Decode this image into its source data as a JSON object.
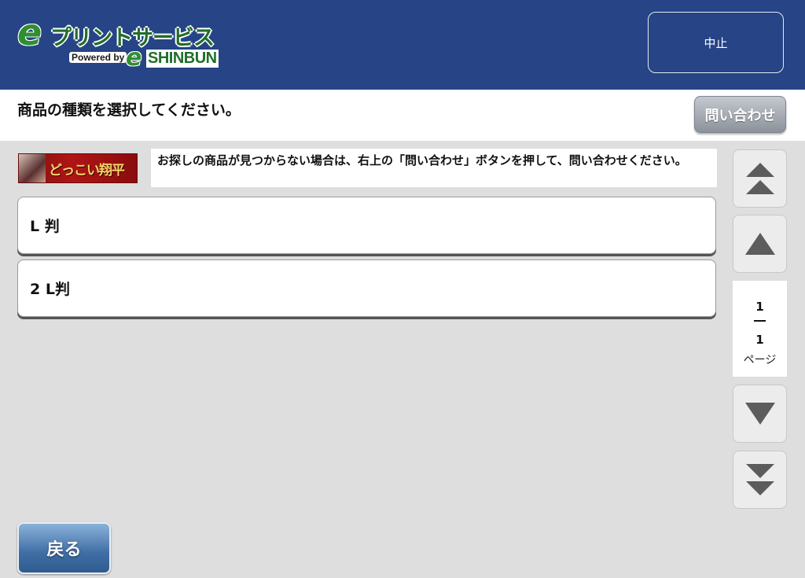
{
  "header": {
    "logo": {
      "title": "プリントサービス",
      "powered_by": "Powered by",
      "brand": "SHINBUN",
      "e_mark": "e"
    },
    "cancel_label": "中止",
    "background_color": "#264486"
  },
  "instruction": {
    "text": "商品の種類を選択してください。",
    "inquiry_label": "問い合わせ"
  },
  "banner": {
    "text": "どっこい翔平"
  },
  "notice": {
    "text": "お探しの商品が見つからない場合は、右上の「問い合わせ」ボタンを押して、問い合わせください。"
  },
  "items": [
    {
      "label": "L 判"
    },
    {
      "label": "2 L判"
    }
  ],
  "pager": {
    "current": "1",
    "total": "1",
    "unit": "ページ",
    "icons": [
      "double-up-arrow-icon",
      "up-arrow-icon",
      "down-arrow-icon",
      "double-down-arrow-icon"
    ]
  },
  "footer": {
    "back_label": "戻る"
  }
}
